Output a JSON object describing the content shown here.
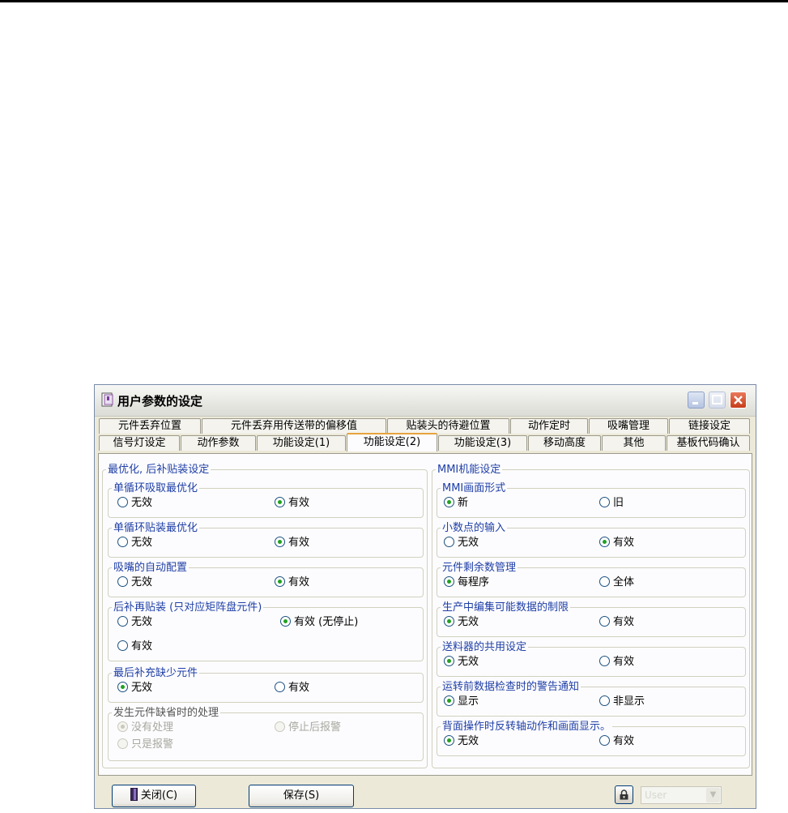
{
  "window": {
    "title": "用户参数的设定"
  },
  "tabs_row1": [
    "元件丢弃位置",
    "元件丢弃用传送带的偏移值",
    "贴装头的待避位置",
    "动作定时",
    "吸嘴管理",
    "链接设定"
  ],
  "tabs_row2": [
    "信号灯设定",
    "动作参数",
    "功能设定(1)",
    "功能设定(2)",
    "功能设定(3)",
    "移动高度",
    "其他",
    "基板代码确认"
  ],
  "left_section": {
    "title": "最优化, 后补贴装设定",
    "groups": [
      {
        "title": "单循环吸取最优化",
        "options": [
          "无效",
          "有效"
        ],
        "selected": 1
      },
      {
        "title": "单循环贴装最优化",
        "options": [
          "无效",
          "有效"
        ],
        "selected": 1
      },
      {
        "title": "吸嘴的自动配置",
        "options": [
          "无效",
          "有效"
        ],
        "selected": 1
      },
      {
        "title": "后补再贴装 (只对应矩阵盘元件)",
        "options": [
          "无效",
          "有效 (无停止)",
          "有效"
        ],
        "selected": 1
      },
      {
        "title": "最后补充缺少元件",
        "options": [
          "无效",
          "有效"
        ],
        "selected": 0
      },
      {
        "title": "发生元件缺省时的处理",
        "options": [
          "没有处理",
          "停止后报警",
          "只是报警"
        ],
        "selected": 0,
        "disabled": true
      }
    ]
  },
  "right_section": {
    "title": "MMI机能设定",
    "groups": [
      {
        "title": "MMI画面形式",
        "options": [
          "新",
          "旧"
        ],
        "selected": 0
      },
      {
        "title": "小数点的输入",
        "options": [
          "无效",
          "有效"
        ],
        "selected": 1
      },
      {
        "title": "元件剩余数管理",
        "options": [
          "每程序",
          "全体"
        ],
        "selected": 0
      },
      {
        "title": "生产中编集可能数据的制限",
        "options": [
          "无效",
          "有效"
        ],
        "selected": 0
      },
      {
        "title": "送料器的共用设定",
        "options": [
          "无效",
          "有效"
        ],
        "selected": 0
      },
      {
        "title": "运转前数据检查时的警告通知",
        "options": [
          "显示",
          "非显示"
        ],
        "selected": 0
      },
      {
        "title": "背面操作时反转轴动作和画面显示。",
        "options": [
          "无效",
          "有效"
        ],
        "selected": 0
      }
    ]
  },
  "footer": {
    "close_label": "关闭(C)",
    "save_label": "保存(S)",
    "user_value": "User"
  }
}
